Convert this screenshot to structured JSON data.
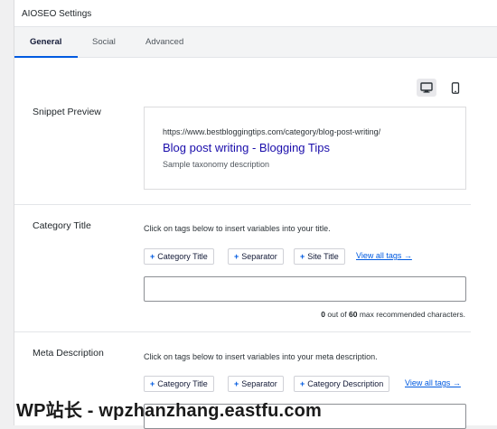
{
  "panel": {
    "title": "AIOSEO Settings"
  },
  "tabs": [
    {
      "label": "General",
      "active": true
    },
    {
      "label": "Social",
      "active": false
    },
    {
      "label": "Advanced",
      "active": false
    }
  ],
  "device_toggle": {
    "selected": "desktop",
    "icons": [
      "desktop-icon",
      "mobile-icon"
    ]
  },
  "snippet_preview": {
    "label": "Snippet Preview",
    "url": "https://www.bestbloggingtips.com/category/blog-post-writing/",
    "title": "Blog post writing - Blogging Tips",
    "description": "Sample taxonomy description"
  },
  "category_title": {
    "label": "Category Title",
    "help": "Click on tags below to insert variables into your title.",
    "tags": [
      "Category Title",
      "Separator",
      "Site Title"
    ],
    "view_all": "View all tags →",
    "value": "",
    "char_count": "0",
    "char_max": "60",
    "char_text_pre": " out of ",
    "char_text_post": " max recommended characters."
  },
  "meta_description": {
    "label": "Meta Description",
    "help": "Click on tags below to insert variables into your meta description.",
    "tags": [
      "Category Title",
      "Separator",
      "Category Description"
    ],
    "view_all": "View all tags →",
    "value": ""
  },
  "watermark": "WP站长 - wpzhanzhang.eastfu.com",
  "colors": {
    "accent": "#005ae0",
    "link_title": "#1a0dab",
    "tab_bg": "#f3f4f5"
  }
}
